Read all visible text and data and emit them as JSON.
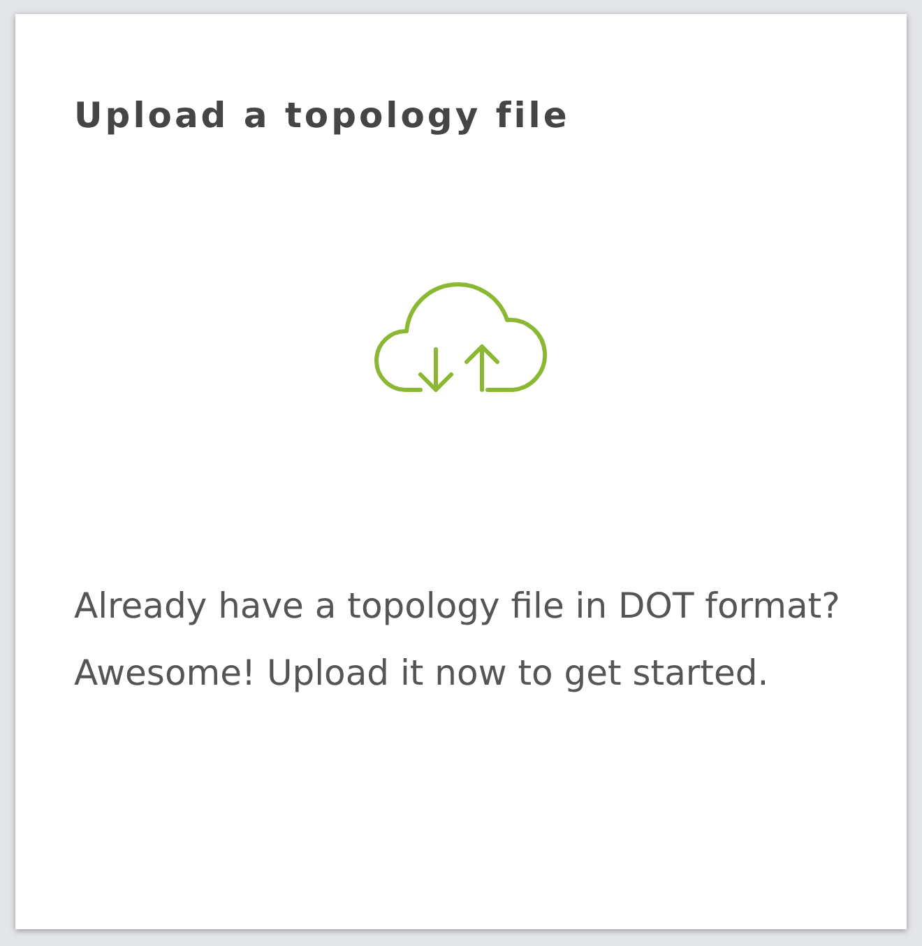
{
  "card": {
    "title": "Upload a topology file",
    "description": "Already have a topology file in DOT format? Awesome! Upload it now to get started."
  }
}
